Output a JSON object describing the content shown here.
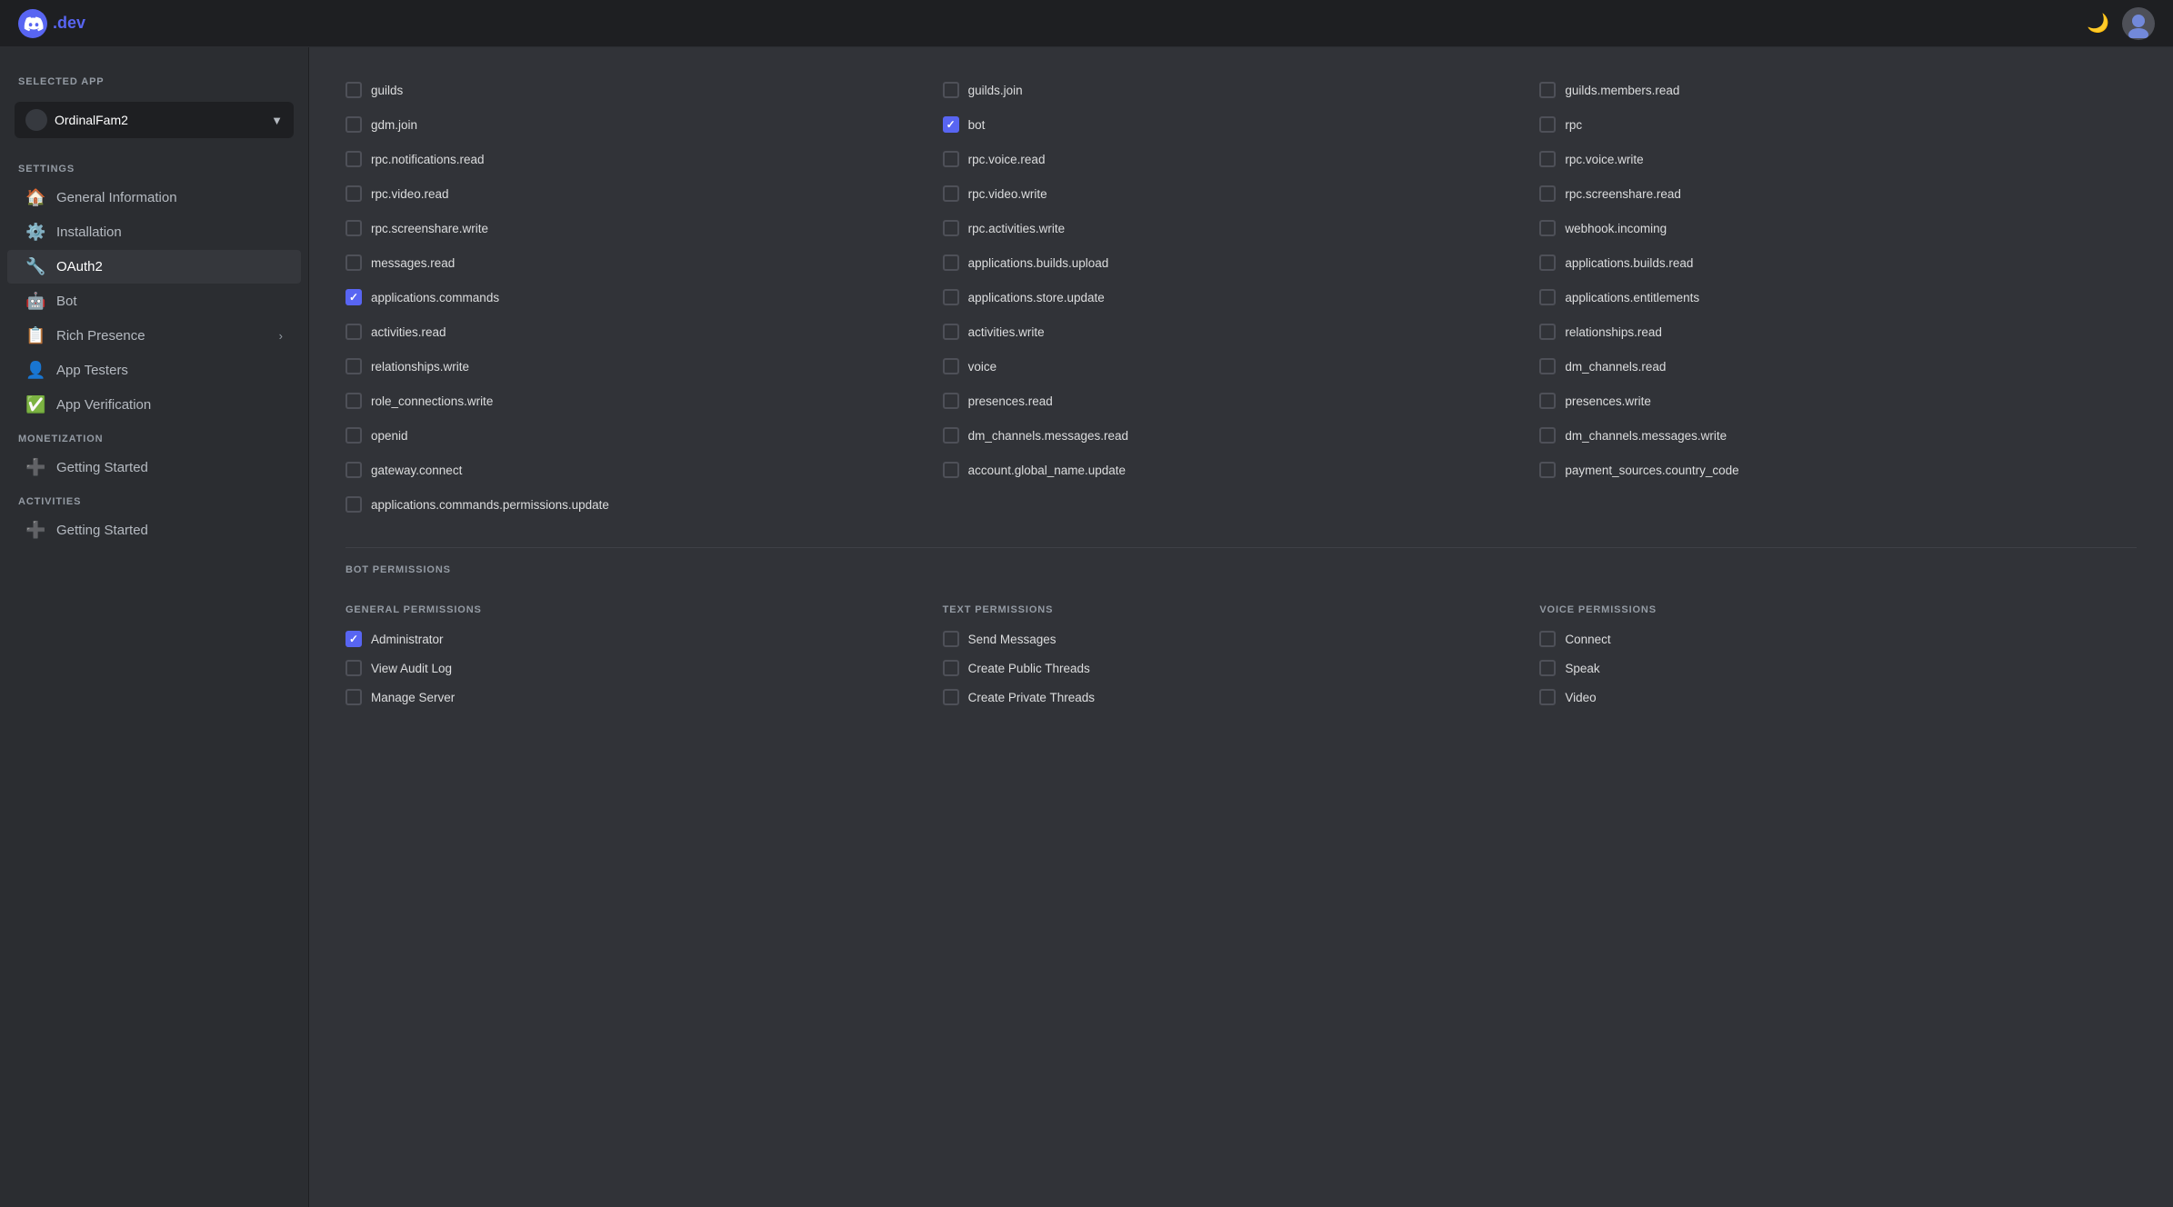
{
  "topbar": {
    "logo_text": ".dev",
    "moon_icon": "🌙"
  },
  "sidebar": {
    "selected_app_label": "SELECTED APP",
    "app_name": "OrdinalFam2",
    "settings_label": "SETTINGS",
    "nav_items": [
      {
        "id": "general-information",
        "icon": "🏠",
        "label": "General Information",
        "active": false,
        "arrow": false
      },
      {
        "id": "installation",
        "icon": "⚙",
        "label": "Installation",
        "active": false,
        "arrow": false
      },
      {
        "id": "oauth2",
        "icon": "🔧",
        "label": "OAuth2",
        "active": true,
        "arrow": false
      },
      {
        "id": "bot",
        "icon": "🤖",
        "label": "Bot",
        "active": false,
        "arrow": false
      },
      {
        "id": "rich-presence",
        "icon": "📋",
        "label": "Rich Presence",
        "active": false,
        "arrow": true
      },
      {
        "id": "app-testers",
        "icon": "👤",
        "label": "App Testers",
        "active": false,
        "arrow": false
      },
      {
        "id": "app-verification",
        "icon": "✅",
        "label": "App Verification",
        "active": false,
        "arrow": false
      }
    ],
    "monetization_label": "MONETIZATION",
    "monetization_items": [
      {
        "id": "monetization-getting-started",
        "icon": "➕",
        "label": "Getting Started",
        "active": false
      }
    ],
    "activities_label": "ACTIVITIES",
    "activities_items": [
      {
        "id": "activities-getting-started",
        "icon": "➕",
        "label": "Getting Started",
        "active": false
      }
    ]
  },
  "scopes": [
    {
      "id": "guilds",
      "label": "guilds",
      "checked": false
    },
    {
      "id": "guilds-join",
      "label": "guilds.join",
      "checked": false
    },
    {
      "id": "guilds-members-read",
      "label": "guilds.members.read",
      "checked": false
    },
    {
      "id": "gdm-join",
      "label": "gdm.join",
      "checked": false
    },
    {
      "id": "bot",
      "label": "bot",
      "checked": true
    },
    {
      "id": "rpc",
      "label": "rpc",
      "checked": false
    },
    {
      "id": "rpc-notifications-read",
      "label": "rpc.notifications.read",
      "checked": false
    },
    {
      "id": "rpc-voice-read",
      "label": "rpc.voice.read",
      "checked": false
    },
    {
      "id": "rpc-voice-write",
      "label": "rpc.voice.write",
      "checked": false
    },
    {
      "id": "rpc-video-read",
      "label": "rpc.video.read",
      "checked": false
    },
    {
      "id": "rpc-video-write",
      "label": "rpc.video.write",
      "checked": false
    },
    {
      "id": "rpc-screenshare-read",
      "label": "rpc.screenshare.read",
      "checked": false
    },
    {
      "id": "rpc-screenshare-write",
      "label": "rpc.screenshare.write",
      "checked": false
    },
    {
      "id": "rpc-activities-write",
      "label": "rpc.activities.write",
      "checked": false
    },
    {
      "id": "webhook-incoming",
      "label": "webhook.incoming",
      "checked": false
    },
    {
      "id": "messages-read",
      "label": "messages.read",
      "checked": false
    },
    {
      "id": "applications-builds-upload",
      "label": "applications.builds.upload",
      "checked": false
    },
    {
      "id": "applications-builds-read",
      "label": "applications.builds.read",
      "checked": false
    },
    {
      "id": "applications-commands",
      "label": "applications.commands",
      "checked": true
    },
    {
      "id": "applications-store-update",
      "label": "applications.store.update",
      "checked": false
    },
    {
      "id": "applications-entitlements",
      "label": "applications.entitlements",
      "checked": false
    },
    {
      "id": "activities-read",
      "label": "activities.read",
      "checked": false
    },
    {
      "id": "activities-write",
      "label": "activities.write",
      "checked": false
    },
    {
      "id": "relationships-read",
      "label": "relationships.read",
      "checked": false
    },
    {
      "id": "relationships-write",
      "label": "relationships.write",
      "checked": false
    },
    {
      "id": "voice",
      "label": "voice",
      "checked": false
    },
    {
      "id": "dm-channels-read",
      "label": "dm_channels.read",
      "checked": false
    },
    {
      "id": "role-connections-write",
      "label": "role_connections.write",
      "checked": false
    },
    {
      "id": "presences-read",
      "label": "presences.read",
      "checked": false
    },
    {
      "id": "presences-write",
      "label": "presences.write",
      "checked": false
    },
    {
      "id": "openid",
      "label": "openid",
      "checked": false
    },
    {
      "id": "dm-channels-messages-read",
      "label": "dm_channels.messages.read",
      "checked": false
    },
    {
      "id": "dm-channels-messages-write",
      "label": "dm_channels.messages.write",
      "checked": false
    },
    {
      "id": "gateway-connect",
      "label": "gateway.connect",
      "checked": false
    },
    {
      "id": "account-global-name-update",
      "label": "account.global_name.update",
      "checked": false
    },
    {
      "id": "payment-sources-country-code",
      "label": "payment_sources.country_code",
      "checked": false
    },
    {
      "id": "applications-commands-permissions-update",
      "label": "applications.commands.permissions.update",
      "checked": false
    }
  ],
  "bot_permissions_header": "BOT PERMISSIONS",
  "general_permissions_header": "GENERAL PERMISSIONS",
  "text_permissions_header": "TEXT PERMISSIONS",
  "voice_permissions_header": "VOICE PERMISSIONS",
  "general_permissions": [
    {
      "id": "administrator",
      "label": "Administrator",
      "checked": true
    },
    {
      "id": "view-audit-log",
      "label": "View Audit Log",
      "checked": false
    },
    {
      "id": "manage-server",
      "label": "Manage Server",
      "checked": false
    }
  ],
  "text_permissions": [
    {
      "id": "send-messages",
      "label": "Send Messages",
      "checked": false
    },
    {
      "id": "create-public-threads",
      "label": "Create Public Threads",
      "checked": false
    },
    {
      "id": "create-private-threads",
      "label": "Create Private Threads",
      "checked": false
    }
  ],
  "voice_permissions": [
    {
      "id": "connect",
      "label": "Connect",
      "checked": false
    },
    {
      "id": "speak",
      "label": "Speak",
      "checked": false
    },
    {
      "id": "video",
      "label": "Video",
      "checked": false
    }
  ]
}
